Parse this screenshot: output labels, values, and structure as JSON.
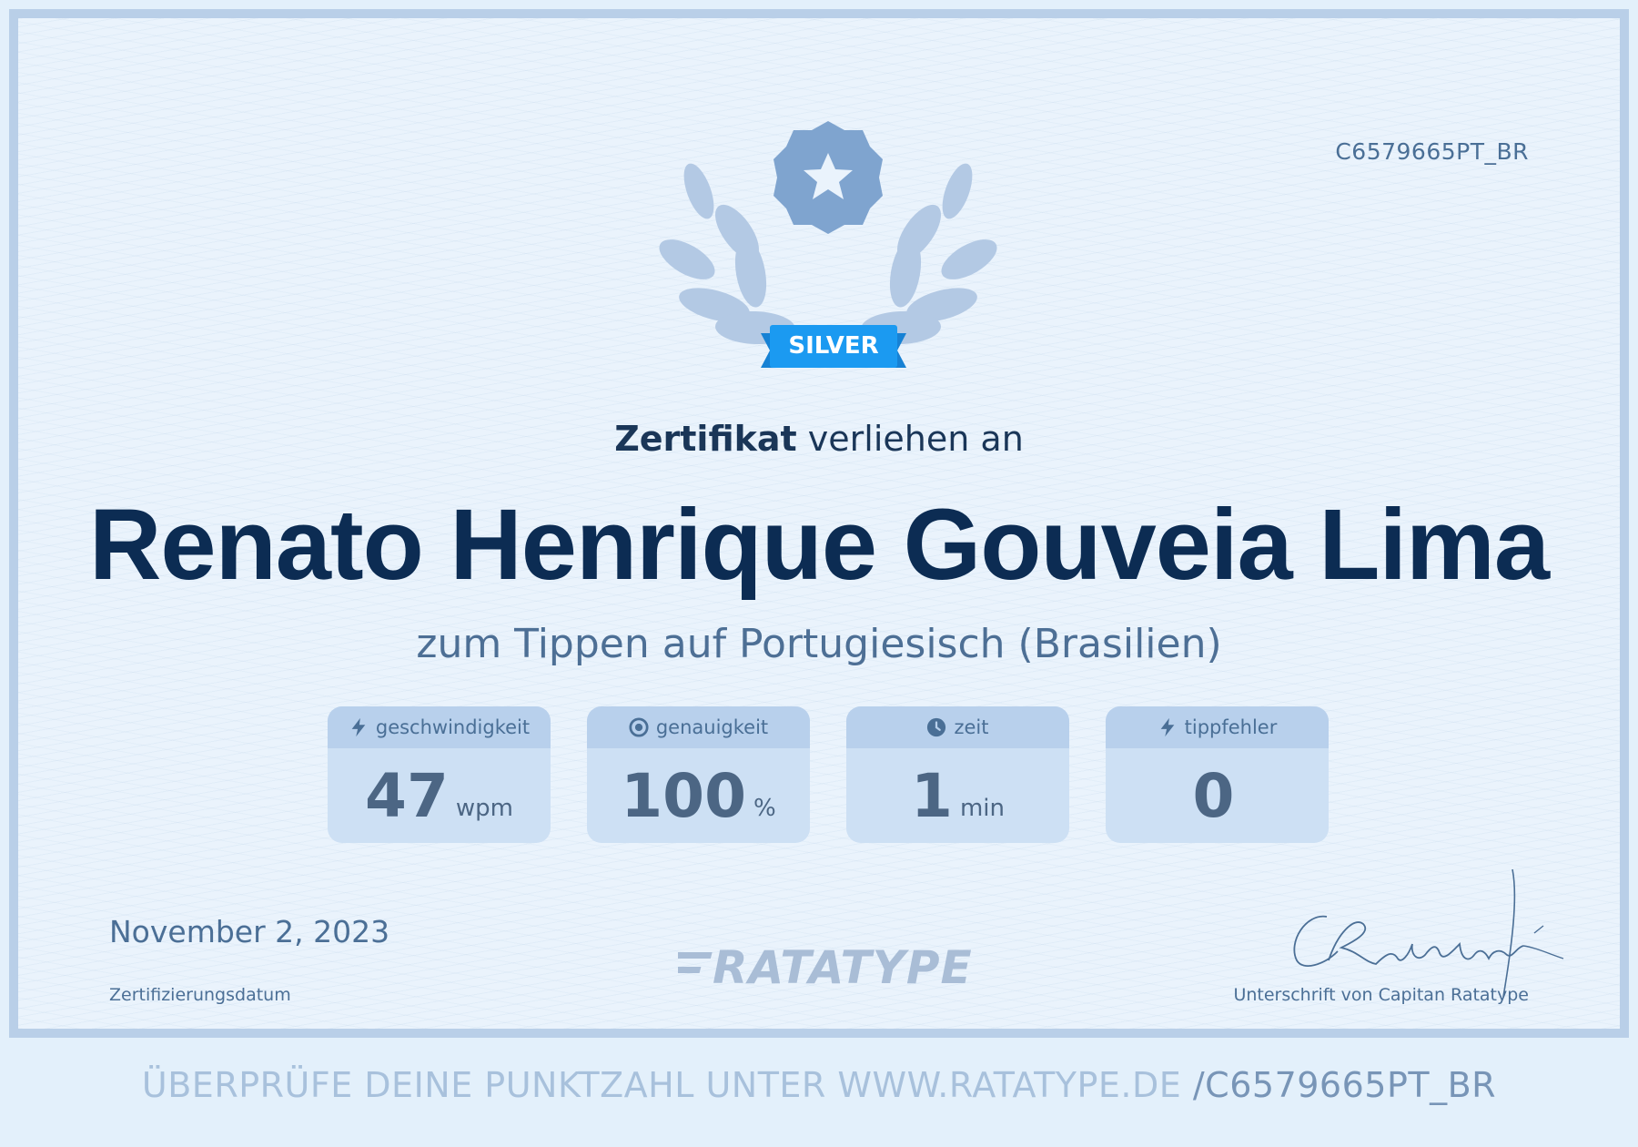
{
  "certificate": {
    "id_code": "C6579665PT_BR",
    "badge_label": "SILVER",
    "heading_bold": "Zertifikat",
    "heading_rest": " verliehen an",
    "recipient_name": "Renato Henrique Gouveia Lima",
    "subtitle": "zum Tippen auf Portugiesisch (Brasilien)",
    "stats": [
      {
        "label": "geschwindigkeit",
        "icon": "lightning-icon",
        "value": "47",
        "unit": "wpm"
      },
      {
        "label": "genauigkeit",
        "icon": "target-icon",
        "value": "100",
        "unit": "%"
      },
      {
        "label": "zeit",
        "icon": "clock-icon",
        "value": "1",
        "unit": "min"
      },
      {
        "label": "tippfehler",
        "icon": "lightning-icon",
        "value": "0",
        "unit": ""
      }
    ],
    "date": "November 2, 2023",
    "date_label": "Zertifizierungsdatum",
    "logo_text": "RATATYPE",
    "signature_text": "CRatatype",
    "signature_label": "Unterschrift von Capitan Ratatype"
  },
  "footer": {
    "text": "ÜBERPRÜFE DEINE PUNKTZAHL UNTER WWW.RATATYPE.DE",
    "code": "/C6579665PT_BR"
  },
  "colors": {
    "name": "#0c2c53",
    "accent": "#1b9af1",
    "muted": "#4b6f96",
    "border": "#b9cfe8"
  }
}
